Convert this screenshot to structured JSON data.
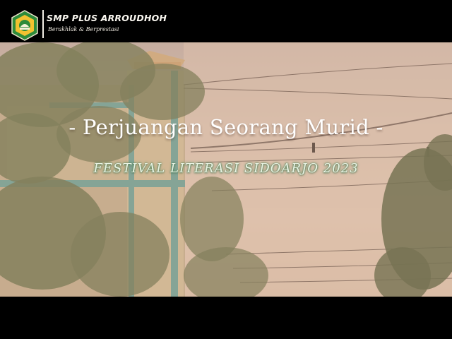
{
  "header": {
    "logo_icon": "school-emblem-icon",
    "school_name": "SMP PLUS ARROUDHOH",
    "motto": "Berakhlak & Berprestasi"
  },
  "main": {
    "title": "- Perjuangan Seorang Murid -",
    "subtitle": "FESTIVAL LITERASI SIDOARJO 2023"
  },
  "colors": {
    "letterbox": "#000000",
    "title_text": "#ffffff",
    "subtitle_glow": "#4f8a5c",
    "logo_green": "#2e8b3a",
    "logo_yellow": "#f2c230"
  }
}
